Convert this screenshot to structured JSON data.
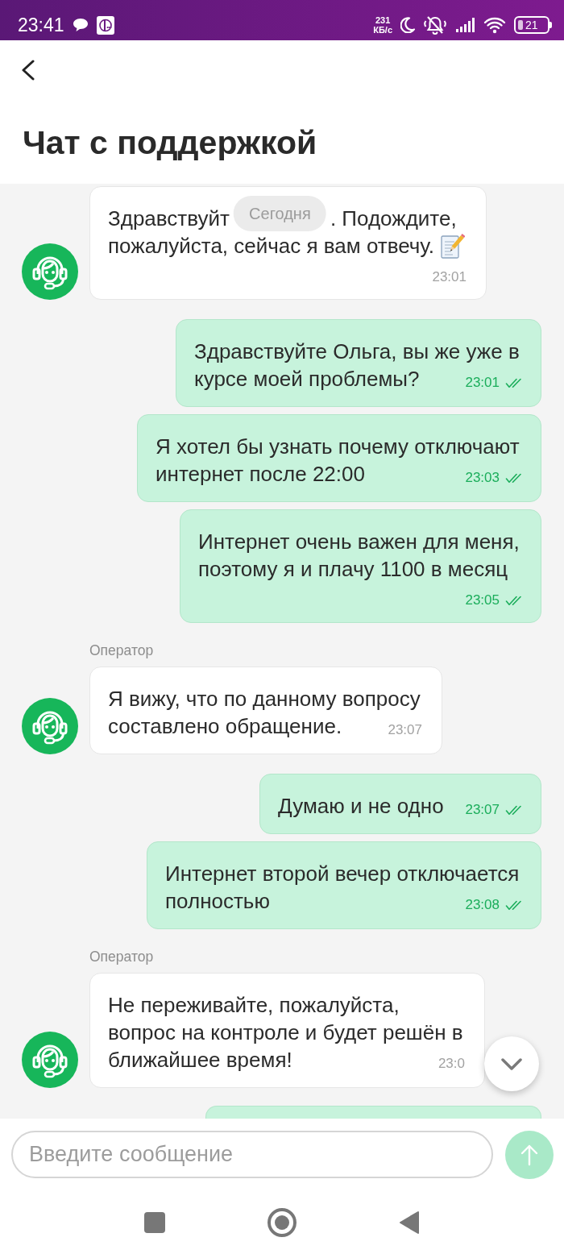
{
  "status_bar": {
    "time": "23:41",
    "net_speed": "231",
    "net_speed_unit": "КБ/с",
    "battery": "21"
  },
  "header": {
    "title": "Чат с поддержкой"
  },
  "chat": {
    "date_header": "Сегодня",
    "scroll_down_button": true,
    "messages": [
      {
        "kind": "operator",
        "text_before_date": "Здравствуйт",
        "text_after_date": ". Подождите,",
        "text": "пожалуйста, сейчас я вам отвечу.",
        "emoji": true,
        "time": "23:01"
      },
      {
        "kind": "user",
        "text": "Здравствуйте Ольга, вы же уже в\nкурсе моей проблемы?",
        "time": "23:01",
        "read": true
      },
      {
        "kind": "user",
        "text": "Я хотел бы узнать почему отключают\nинтернет после 22:00",
        "time": "23:03",
        "read": true
      },
      {
        "kind": "user",
        "text": "Интернет очень важен для меня,\nпоэтому я и плачу 1100 в месяц",
        "time": "23:05",
        "read": true
      },
      {
        "kind": "operator",
        "author": "Оператор",
        "text": "Я вижу, что по данному вопросу\nсоставлено обращение.",
        "time": "23:07"
      },
      {
        "kind": "user",
        "text": "Думаю и не одно",
        "time": "23:07",
        "read": true
      },
      {
        "kind": "user",
        "text": "Интернет второй вечер отключается\nполностью",
        "time": "23:08",
        "read": true
      },
      {
        "kind": "operator",
        "author": "Оператор",
        "text": "Не переживайте, пожалуйста,\nвопрос на контроле и будет решён в\nближайшее время!",
        "time": "23:0"
      },
      {
        "kind": "user"
      }
    ]
  },
  "composer": {
    "placeholder": "Введите сообщение",
    "send_disabled": true
  }
}
